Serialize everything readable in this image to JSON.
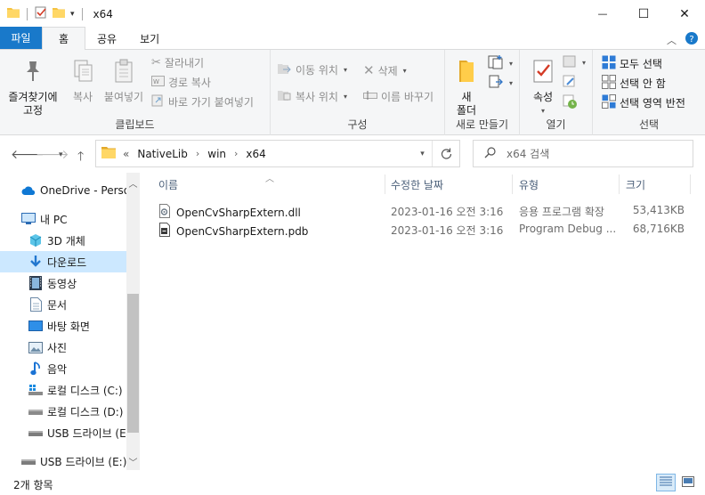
{
  "window": {
    "title": "x64",
    "controls": {
      "minimize": "—",
      "maximize": "☐",
      "close": "✕"
    }
  },
  "ribbon_tabs": [
    {
      "label": "파일"
    },
    {
      "label": "홈"
    },
    {
      "label": "공유"
    },
    {
      "label": "보기"
    }
  ],
  "ribbon": {
    "clipboard": {
      "pin_label": "즐겨찾기에\n고정",
      "copy_label": "복사",
      "paste_label": "붙여넣기",
      "cut_label": "잘라내기",
      "copy_path_label": "경로 복사",
      "paste_shortcut_label": "바로 가기 붙여넣기",
      "group_label": "클립보드"
    },
    "organize": {
      "move_to_label": "이동 위치",
      "copy_to_label": "복사 위치",
      "delete_label": "삭제",
      "rename_label": "이름 바꾸기",
      "group_label": "구성"
    },
    "new": {
      "new_folder_label": "새\n폴더",
      "group_label": "새로 만들기"
    },
    "open": {
      "properties_label": "속성",
      "group_label": "열기"
    },
    "select": {
      "select_all_label": "모두 선택",
      "select_none_label": "선택 안 함",
      "invert_selection_label": "선택 영역 반전",
      "group_label": "선택"
    }
  },
  "address": {
    "overflow": "«",
    "crumbs": [
      "NativeLib",
      "win",
      "x64"
    ]
  },
  "search": {
    "placeholder": "x64 검색"
  },
  "navpane": {
    "items": [
      {
        "label": "OneDrive - Personal",
        "icon": "cloud-icon"
      },
      {
        "label": "내 PC",
        "icon": "computer-icon"
      },
      {
        "label": "3D 개체",
        "icon": "cube-icon"
      },
      {
        "label": "다운로드",
        "icon": "download-icon"
      },
      {
        "label": "동영상",
        "icon": "video-icon"
      },
      {
        "label": "문서",
        "icon": "document-icon"
      },
      {
        "label": "바탕 화면",
        "icon": "desktop-icon"
      },
      {
        "label": "사진",
        "icon": "picture-icon"
      },
      {
        "label": "음악",
        "icon": "music-icon"
      },
      {
        "label": "로컬 디스크 (C:)",
        "icon": "system-drive-icon"
      },
      {
        "label": "로컬 디스크 (D:)",
        "icon": "drive-icon"
      },
      {
        "label": "USB 드라이브 (E:)",
        "icon": "usb-drive-icon"
      },
      {
        "label": "USB 드라이브 (E:)",
        "icon": "usb-drive-icon"
      }
    ]
  },
  "filelist": {
    "columns": [
      "이름",
      "수정한 날짜",
      "유형",
      "크기"
    ],
    "rows": [
      {
        "name": "OpenCvSharpExtern.dll",
        "modified": "2023-01-16 오전 3:16",
        "type": "응용 프로그램 확장",
        "size": "53,413KB",
        "icon": "dll-file-icon"
      },
      {
        "name": "OpenCvSharpExtern.pdb",
        "modified": "2023-01-16 오전 3:16",
        "type": "Program Debug ...",
        "size": "68,716KB",
        "icon": "pdb-file-icon"
      }
    ]
  },
  "status": {
    "item_count": "2개 항목"
  },
  "colors": {
    "accent": "#1979ca",
    "selected": "#cce8ff",
    "folder": "#f5c342"
  }
}
